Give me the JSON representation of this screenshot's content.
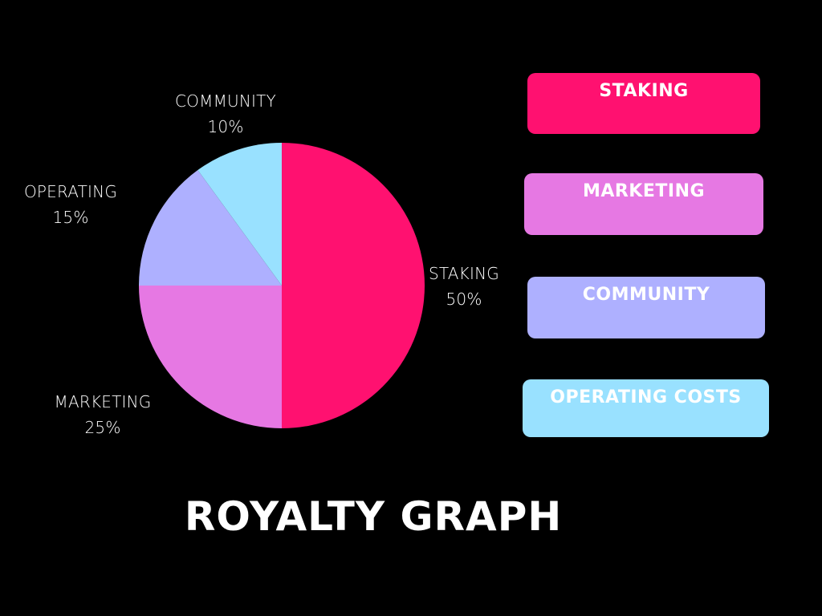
{
  "chart_data": {
    "type": "pie",
    "title": "ROYALTY GRAPH",
    "slices": [
      {
        "label": "STAKING",
        "value": 50,
        "value_text": "50%",
        "color": "#ff1170"
      },
      {
        "label": "MARKETING",
        "value": 25,
        "value_text": "25%",
        "color": "#e678e3"
      },
      {
        "label": "OPERATING",
        "value": 15,
        "value_text": "15%",
        "color": "#aeb0ff"
      },
      {
        "label": "COMMUNITY",
        "value": 10,
        "value_text": "10%",
        "color": "#99e1ff"
      }
    ],
    "legend": [
      {
        "label": "STAKING",
        "color": "#ff1170"
      },
      {
        "label": "MARKETING",
        "color": "#e678e3"
      },
      {
        "label": "COMMUNITY",
        "color": "#aeb0ff"
      },
      {
        "label": "OPERATING COSTS",
        "color": "#99e1ff"
      }
    ]
  }
}
